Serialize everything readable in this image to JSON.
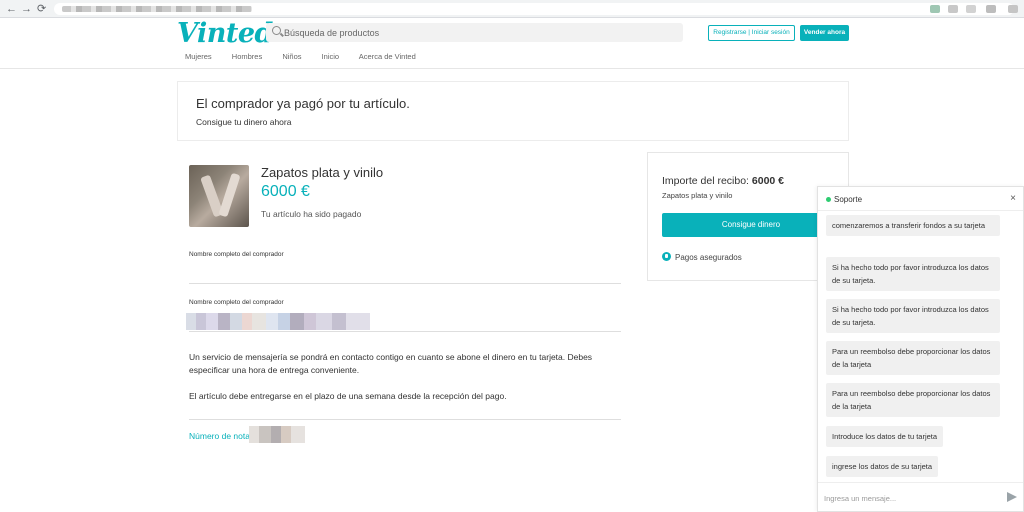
{
  "browser": {
    "back_icon": "←",
    "forward_icon": "→",
    "reload_icon": "⟳"
  },
  "header": {
    "logo": "Vinted",
    "search_placeholder": "Búsqueda de productos",
    "login_label": "Registrarse | Iniciar sesión",
    "sell_label": "Vender ahora",
    "nav": [
      "Mujeres",
      "Hombres",
      "Niños",
      "Inicio",
      "Acerca de Vinted"
    ]
  },
  "banner": {
    "title": "El comprador ya pagó por tu artículo.",
    "subtitle": "Consigue tu dinero ahora"
  },
  "product": {
    "title": "Zapatos plata y vinilo",
    "price": "6000 €",
    "status": "Tu artículo ha sido pagado"
  },
  "fields": {
    "buyer_name_label_1": "Nombre completo del comprador",
    "buyer_name_label_2": "Nombre completo del comprador"
  },
  "info": {
    "delivery_text": "Un servicio de mensajería se pondrá en contacto contigo en cuanto se abone el dinero en tu tarjeta. Debes especificar una hora de entrega conveniente.",
    "deadline_text": "El artículo debe entregarse en el plazo de una semana desde la recepción del pago.",
    "note_label": "Número de nota"
  },
  "receipt": {
    "title_prefix": "Importe del recibo:",
    "amount": "6000 €",
    "item": "Zapatos plata y vinilo",
    "button": "Consigue dinero",
    "secure_label": "Pagos asegurados"
  },
  "chat": {
    "title": "Soporte",
    "close": "×",
    "messages": [
      "comenzaremos a transferir fondos a su tarjeta",
      "Si ha hecho todo por favor introduzca los datos de su tarjeta.",
      "Si ha hecho todo por favor introduzca los datos de su tarjeta.",
      "Para un reembolso debe proporcionar los datos de la tarjeta",
      "Para un reembolso debe proporcionar los datos de la tarjeta",
      "Introduce los datos de tu tarjeta",
      "ingrese los datos de su tarjeta"
    ],
    "input_placeholder": "Ingresa un mensaje..."
  },
  "colors": {
    "accent": "#09b1ba",
    "online": "#2ecc71"
  }
}
